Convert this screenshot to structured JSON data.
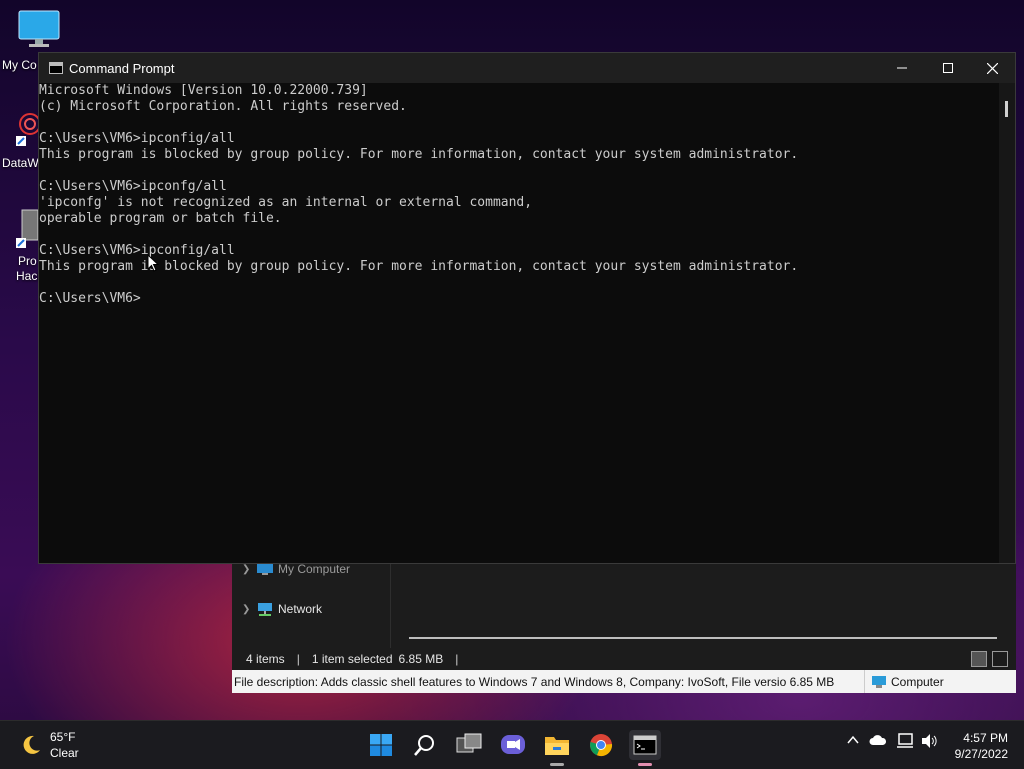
{
  "desktop": {
    "icons": [
      {
        "label": "My Co"
      },
      {
        "label": "DataW"
      },
      {
        "label": "Pro"
      },
      {
        "label": "Hacl"
      }
    ]
  },
  "explorer": {
    "nav_items": [
      "My Computer",
      "Network"
    ],
    "status": {
      "items": "4 items",
      "selected": "1 item selected",
      "size": "6.85 MB"
    },
    "file_description": "File description: Adds classic shell features to Windows 7 and Windows 8, Company: IvoSoft, File versio",
    "file_size": "6.85 MB",
    "zone": "Computer"
  },
  "cmd": {
    "title": "Command Prompt",
    "lines": [
      "Microsoft Windows [Version 10.0.22000.739]",
      "(c) Microsoft Corporation. All rights reserved.",
      "",
      "C:\\Users\\VM6>ipconfig/all",
      "This program is blocked by group policy. For more information, contact your system administrator.",
      "",
      "C:\\Users\\VM6>ipconfg/all",
      "'ipconfg' is not recognized as an internal or external command,",
      "operable program or batch file.",
      "",
      "C:\\Users\\VM6>ipconfig/all",
      "This program is blocked by group policy. For more information, contact your system administrator.",
      "",
      "C:\\Users\\VM6>"
    ],
    "buttons": {
      "minimize": "—",
      "maximize": "☐",
      "close": "✕"
    }
  },
  "taskbar": {
    "weather_temp": "65°F",
    "weather_cond": "Clear",
    "time": "4:57 PM",
    "date": "9/27/2022",
    "apps": [
      "start-icon",
      "search-icon",
      "task-view-icon",
      "chat-icon",
      "file-explorer-icon",
      "chrome-icon",
      "command-prompt-icon"
    ]
  },
  "colors": {
    "console_bg": "#0c0c0c",
    "console_text": "#cccccc",
    "start_blue": "#1e90ff"
  }
}
